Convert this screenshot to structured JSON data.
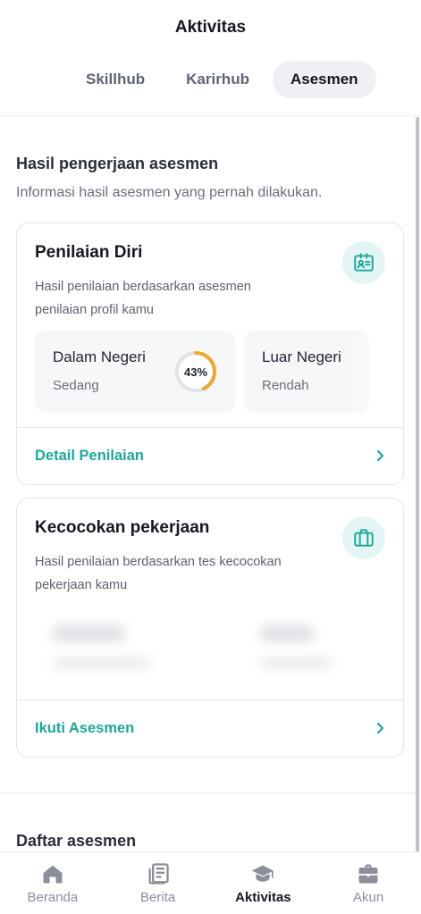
{
  "header": {
    "title": "Aktivitas",
    "tabs": [
      {
        "label": "Skillhub",
        "active": false
      },
      {
        "label": "Karirhub",
        "active": false
      },
      {
        "label": "Asesmen",
        "active": true
      }
    ]
  },
  "section": {
    "title": "Hasil pengerjaan asesmen",
    "subtitle": "Informasi hasil asesmen yang pernah dilakukan."
  },
  "card_penilaian": {
    "title": "Penilaian Diri",
    "description": "Hasil penilaian berdasarkan asesmen penilaian profil kamu",
    "icon": "id-card-icon",
    "items": [
      {
        "title": "Dalam Negeri",
        "status": "Sedang",
        "percent_label": "43%",
        "percent": 43
      },
      {
        "title": "Luar Negeri",
        "status": "Rendah"
      }
    ],
    "link_label": "Detail Penilaian"
  },
  "card_kecocokan": {
    "title": "Kecocokan pekerjaan",
    "description": "Hasil penilaian berdasarkan tes kecocokan pekerjaan kamu",
    "icon": "briefcase-icon",
    "link_label": "Ikuti Asesmen"
  },
  "daftar": {
    "title": "Daftar asesmen"
  },
  "bottom_nav": [
    {
      "label": "Beranda",
      "icon": "home-icon",
      "active": false
    },
    {
      "label": "Berita",
      "icon": "news-icon",
      "active": false
    },
    {
      "label": "Aktivitas",
      "icon": "graduation-cap-icon",
      "active": true
    },
    {
      "label": "Akun",
      "icon": "briefcase-icon",
      "active": false
    }
  ],
  "colors": {
    "accent": "#1aa99b",
    "progress": "#f2a52b",
    "badge_bg": "#e3f6f5",
    "text_dark": "#15181f",
    "text_muted": "#6b6f7a"
  }
}
